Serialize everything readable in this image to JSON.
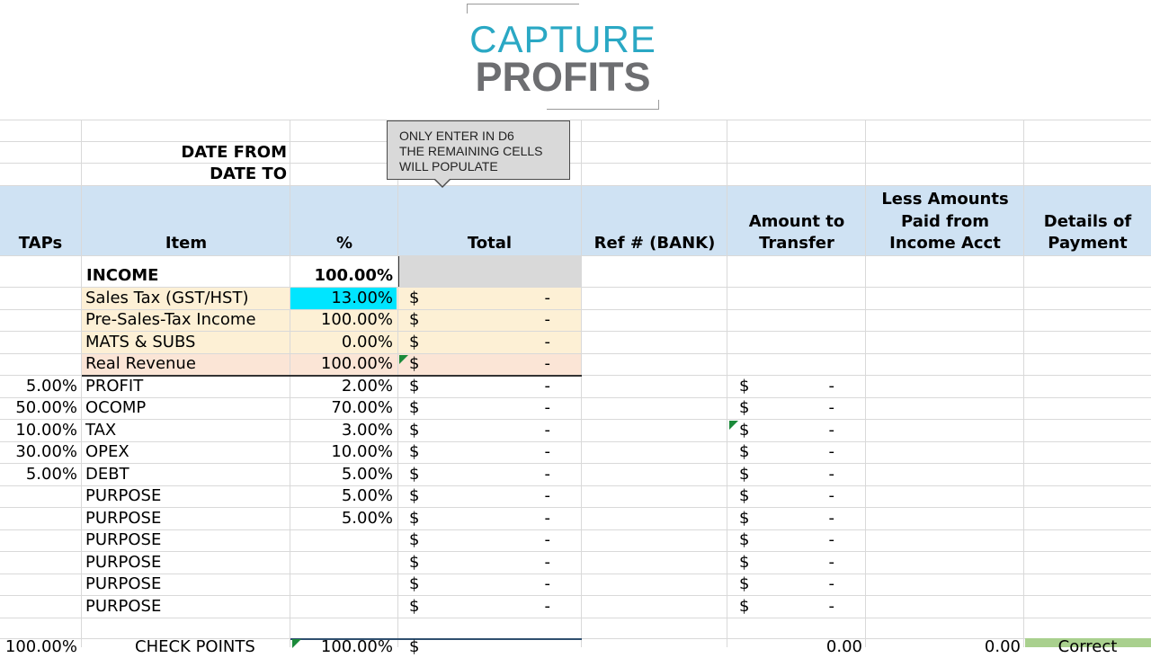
{
  "logo": {
    "line1": "CAPTURE",
    "line2": "PROFITS"
  },
  "dates": {
    "from_label": "DATE FROM",
    "to_label": "DATE TO"
  },
  "callout": {
    "line1": "ONLY ENTER IN D6",
    "line2": "THE REMAINING CELLS",
    "line3": "WILL POPULATE"
  },
  "headers": {
    "taps": "TAPs",
    "item": "Item",
    "pct": "%",
    "total": "Total",
    "ref": "Ref # (BANK)",
    "amount_l1": "Amount to",
    "amount_l2": "Transfer",
    "less_l1": "Less Amounts",
    "less_l2": "Paid from",
    "less_l3": "Income Acct",
    "details_l1": "Details of",
    "details_l2": "Payment"
  },
  "income": {
    "label": "INCOME",
    "pct": "100.00%"
  },
  "rows": [
    {
      "taps": "",
      "item": "Sales Tax (GST/HST)",
      "pct": "13.00%",
      "cur": "$",
      "total": "-",
      "tcur": "",
      "transfer": ""
    },
    {
      "taps": "",
      "item": "Pre-Sales-Tax Income",
      "pct": "100.00%",
      "cur": "$",
      "total": "-",
      "tcur": "",
      "transfer": ""
    },
    {
      "taps": "",
      "item": "MATS & SUBS",
      "pct": "0.00%",
      "cur": "$",
      "total": "-",
      "tcur": "",
      "transfer": ""
    },
    {
      "taps": "",
      "item": "Real Revenue",
      "pct": "100.00%",
      "cur": "$",
      "total": "-",
      "tcur": "",
      "transfer": ""
    },
    {
      "taps": "5.00%",
      "item": "PROFIT",
      "pct": "2.00%",
      "cur": "$",
      "total": "-",
      "tcur": "$",
      "transfer": "-"
    },
    {
      "taps": "50.00%",
      "item": "OCOMP",
      "pct": "70.00%",
      "cur": "$",
      "total": "-",
      "tcur": "$",
      "transfer": "-"
    },
    {
      "taps": "10.00%",
      "item": "TAX",
      "pct": "3.00%",
      "cur": "$",
      "total": "-",
      "tcur": "$",
      "transfer": "-"
    },
    {
      "taps": "30.00%",
      "item": "OPEX",
      "pct": "10.00%",
      "cur": "$",
      "total": "-",
      "tcur": "$",
      "transfer": "-"
    },
    {
      "taps": "5.00%",
      "item": "DEBT",
      "pct": "5.00%",
      "cur": "$",
      "total": "-",
      "tcur": "$",
      "transfer": "-"
    },
    {
      "taps": "",
      "item": "PURPOSE",
      "pct": "5.00%",
      "cur": "$",
      "total": "-",
      "tcur": "$",
      "transfer": "-"
    },
    {
      "taps": "",
      "item": "PURPOSE",
      "pct": "5.00%",
      "cur": "$",
      "total": "-",
      "tcur": "$",
      "transfer": "-"
    },
    {
      "taps": "",
      "item": "PURPOSE",
      "pct": "",
      "cur": "$",
      "total": "-",
      "tcur": "$",
      "transfer": "-"
    },
    {
      "taps": "",
      "item": "PURPOSE",
      "pct": "",
      "cur": "$",
      "total": "-",
      "tcur": "$",
      "transfer": "-"
    },
    {
      "taps": "",
      "item": "PURPOSE",
      "pct": "",
      "cur": "$",
      "total": "-",
      "tcur": "$",
      "transfer": "-"
    },
    {
      "taps": "",
      "item": "PURPOSE",
      "pct": "",
      "cur": "$",
      "total": "-",
      "tcur": "$",
      "transfer": "-"
    }
  ],
  "footer": {
    "taps": "100.00%",
    "label": "CHECK POINTS",
    "pct": "100.00%",
    "cur": "$",
    "amount": "0.00",
    "less": "0.00",
    "details": "Correct"
  },
  "colors": {
    "header_band": "#cfe2f3",
    "income_band": "#fdf0d5",
    "real_revenue": "#fbe5d6",
    "cyan_cell": "#00e5ff",
    "logo_blue": "#2aa8c4",
    "logo_grey": "#6d6e71"
  }
}
